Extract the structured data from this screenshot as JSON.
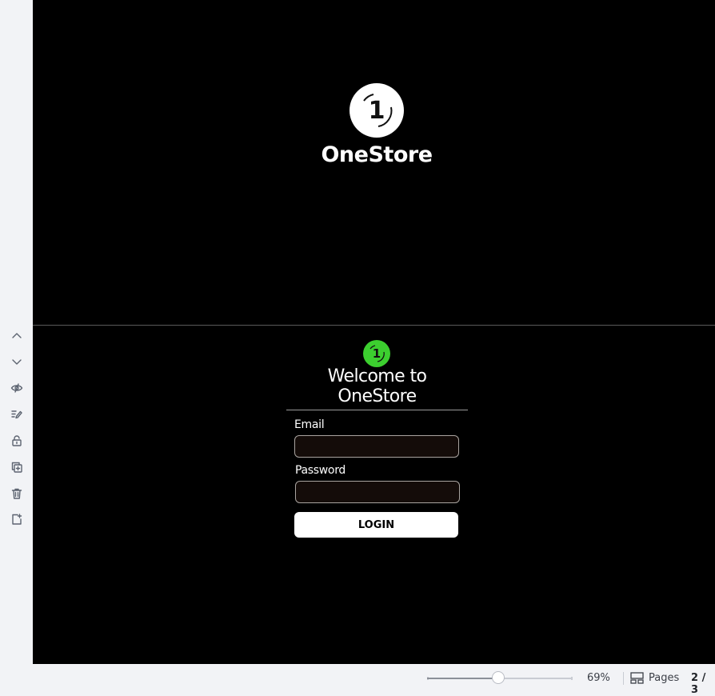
{
  "toolbar": {
    "tools": [
      {
        "icon": "chevron-up-icon"
      },
      {
        "icon": "chevron-down-icon"
      },
      {
        "icon": "hide-eye-icon"
      },
      {
        "icon": "notes-edit-icon"
      },
      {
        "icon": "lock-icon"
      },
      {
        "icon": "duplicate-icon"
      },
      {
        "icon": "trash-icon"
      },
      {
        "icon": "add-page-icon"
      }
    ]
  },
  "splash": {
    "logo_digit": "1",
    "title": "OneStore",
    "logo_color": "#ffffff"
  },
  "login": {
    "logo_digit": "1",
    "logo_color": "#3ccf2f",
    "welcome": "Welcome to OneStore",
    "email_label": "Email",
    "email_value": "",
    "password_label": "Password",
    "password_value": "",
    "login_button": "LOGIN"
  },
  "status_bar": {
    "zoom_percent": 69,
    "zoom_label": "69%",
    "zoom_slider_fraction": 0.49,
    "pages_label": "Pages",
    "page_count": "2 / 3"
  }
}
